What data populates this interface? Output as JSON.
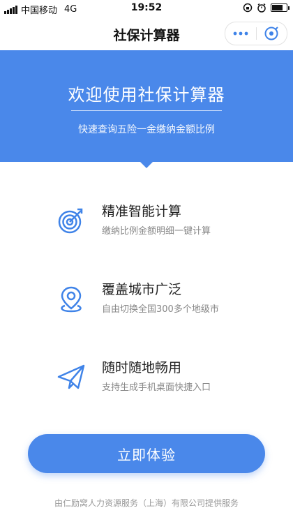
{
  "status_bar": {
    "carrier": "中国移动",
    "network": "4G",
    "time": "19:52",
    "battery_level": 0.85
  },
  "nav": {
    "title": "社保计算器",
    "more_icon": "more-dots-icon",
    "close_icon": "close-circle-icon"
  },
  "hero": {
    "title": "欢迎使用社保计算器",
    "subtitle": "快速查询五险一金缴纳金额比例"
  },
  "features": [
    {
      "icon": "target-icon",
      "title": "精准智能计算",
      "subtitle": "缴纳比例金额明细一键计算"
    },
    {
      "icon": "location-pin-icon",
      "title": "覆盖城市广泛",
      "subtitle": "自由切换全国300多个地级市"
    },
    {
      "icon": "paper-plane-icon",
      "title": "随时随地畅用",
      "subtitle": "支持生成手机桌面快捷入口"
    }
  ],
  "cta": {
    "label": "立即体验"
  },
  "footer": {
    "text": "由仁励窝人力资源服务（上海）有限公司提供服务"
  },
  "colors": {
    "primary": "#4a88ea",
    "icon_blue": "#3f83e8"
  }
}
